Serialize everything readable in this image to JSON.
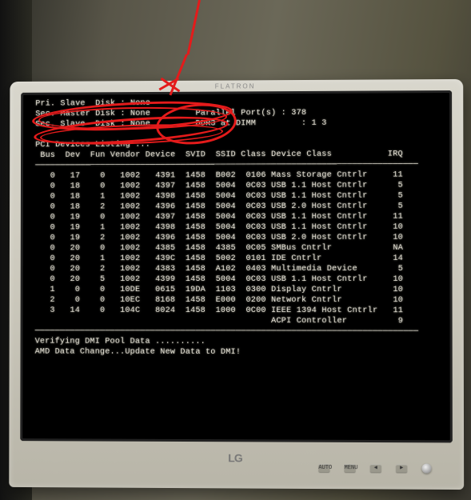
{
  "bios": {
    "disk_lines": [
      {
        "label": "Pri. Slave  Disk",
        "value": "None"
      },
      {
        "label": "Sec. Master Disk",
        "value": "None"
      },
      {
        "label": "Sec. Slave  Disk",
        "value": "None"
      }
    ],
    "right_info": [
      {
        "label": "Parallel Port(s)",
        "value": "378"
      },
      {
        "label": "DDR3 at DIMM",
        "value": "1 3"
      }
    ],
    "pci_heading": "PCI Devices Listing ...",
    "columns": [
      "Bus",
      "Dev",
      "Fun",
      "Vendor",
      "Device",
      "SVID",
      "SSID",
      "Class",
      "Device Class",
      "IRQ"
    ],
    "rows": [
      [
        "0",
        "17",
        "0",
        "1002",
        "4391",
        "1458",
        "B002",
        "0106",
        "Mass Storage Cntrlr",
        "11"
      ],
      [
        "0",
        "18",
        "0",
        "1002",
        "4397",
        "1458",
        "5004",
        "0C03",
        "USB 1.1 Host Cntrlr",
        "5"
      ],
      [
        "0",
        "18",
        "1",
        "1002",
        "4398",
        "1458",
        "5004",
        "0C03",
        "USB 1.1 Host Cntrlr",
        "5"
      ],
      [
        "0",
        "18",
        "2",
        "1002",
        "4396",
        "1458",
        "5004",
        "0C03",
        "USB 2.0 Host Cntrlr",
        "5"
      ],
      [
        "0",
        "19",
        "0",
        "1002",
        "4397",
        "1458",
        "5004",
        "0C03",
        "USB 1.1 Host Cntrlr",
        "11"
      ],
      [
        "0",
        "19",
        "1",
        "1002",
        "4398",
        "1458",
        "5004",
        "0C03",
        "USB 1.1 Host Cntrlr",
        "10"
      ],
      [
        "0",
        "19",
        "2",
        "1002",
        "4396",
        "1458",
        "5004",
        "0C03",
        "USB 2.0 Host Cntrlr",
        "10"
      ],
      [
        "0",
        "20",
        "0",
        "1002",
        "4385",
        "1458",
        "4385",
        "0C05",
        "SMBus Cntrlr",
        "NA"
      ],
      [
        "0",
        "20",
        "1",
        "1002",
        "439C",
        "1458",
        "5002",
        "0101",
        "IDE Cntrlr",
        "14"
      ],
      [
        "0",
        "20",
        "2",
        "1002",
        "4383",
        "1458",
        "A102",
        "0403",
        "Multimedia Device",
        "5"
      ],
      [
        "0",
        "20",
        "5",
        "1002",
        "4399",
        "1458",
        "5004",
        "0C03",
        "USB 1.1 Host Cntrlr",
        "10"
      ],
      [
        "1",
        "0",
        "0",
        "10DE",
        "0615",
        "19DA",
        "1103",
        "0300",
        "Display Cntrlr",
        "10"
      ],
      [
        "2",
        "0",
        "0",
        "10EC",
        "8168",
        "1458",
        "E000",
        "0200",
        "Network Cntrlr",
        "10"
      ],
      [
        "3",
        "14",
        "0",
        "104C",
        "8024",
        "1458",
        "1000",
        "0C00",
        "IEEE 1394 Host Cntrlr",
        "11"
      ],
      [
        "",
        "",
        "",
        "",
        "",
        "",
        "",
        "",
        "ACPI Controller",
        "9"
      ]
    ],
    "footer1": "Verifying DMI Pool Data ..........",
    "footer2": "AMD Data Change...Update New Data to DMI!"
  },
  "monitor": {
    "brand_top": "FLATRON",
    "logo": "LG",
    "btn_labels": [
      "AUTO",
      "MENU",
      "◄",
      "►",
      "⏻"
    ]
  },
  "annotation_color": "#e41b1b"
}
